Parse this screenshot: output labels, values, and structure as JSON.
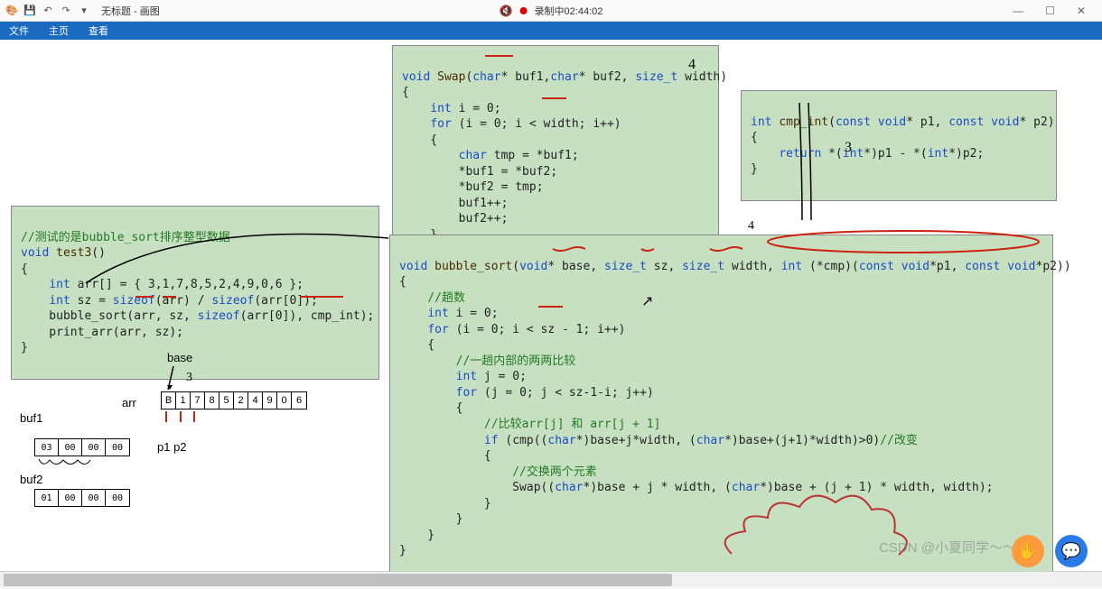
{
  "title_bar": {
    "app_title": "无标题 - 画图",
    "record_label": "录制中02:44:02"
  },
  "ribbon": {
    "file": "文件",
    "home": "主页",
    "view": "查看"
  },
  "panels": {
    "test": {
      "comment": "//测试的是bubble_sort排序整型数据",
      "l1": "void test3()",
      "l2": "{",
      "l3": "    int arr[] = { 3,1,7,8,5,2,4,9,0,6 };",
      "l4": "    int sz = sizeof(arr) / sizeof(arr[0]);",
      "l5": "    bubble_sort(arr, sz, sizeof(arr[0]), cmp_int);",
      "l6": "    print_arr(arr, sz);",
      "l7": "}"
    },
    "swap": {
      "l1": "void Swap(char* buf1,char* buf2, size_t width)",
      "l2": "{",
      "l3": "    int i = 0;",
      "l4": "    for (i = 0; i < width; i++)",
      "l5": "    {",
      "l6": "        char tmp = *buf1;",
      "l7": "        *buf1 = *buf2;",
      "l8": "        *buf2 = tmp;",
      "l9": "        buf1++;",
      "l10": "        buf2++;",
      "l11": "    }",
      "l12": "}"
    },
    "cmp": {
      "l1": "int cmp_int(const void* p1, const void* p2)",
      "l2": "{",
      "l3": "    return *(int*)p1 - *(int*)p2;",
      "l4": "}"
    },
    "bubble": {
      "l1": "void bubble_sort(void* base, size_t sz, size_t width, int (*cmp)(const void*p1, const void*p2))",
      "l2": "{",
      "l3": "    //趟数",
      "l4": "    int i = 0;",
      "l5": "    for (i = 0; i < sz - 1; i++)",
      "l6": "    {",
      "l7": "        //一趟内部的两两比较",
      "l8": "        int j = 0;",
      "l9": "        for (j = 0; j < sz-1-i; j++)",
      "l10": "        {",
      "l11": "            //比较arr[j] 和 arr[j + 1]",
      "l12": "            if (cmp((char*)base+j*width, (char*)base+(j+1)*width)>0)//改变",
      "l13": "            {",
      "l14": "                //交换两个元素",
      "l15": "                Swap((char*)base + j * width, (char*)base + (j + 1) * width, width);",
      "l16": "            }",
      "l17": "        }",
      "l18": "    }",
      "l19": "}"
    }
  },
  "labels": {
    "base": "base",
    "arr": "arr",
    "buf1": "buf1",
    "buf2": "buf2",
    "p1p2": "p1 p2"
  },
  "memory": {
    "arr_cells": [
      "B",
      "1",
      "7",
      "8",
      "5",
      "2",
      "4",
      "9",
      "0",
      "6"
    ],
    "buf1_cells": [
      "03",
      "00",
      "00",
      "00"
    ],
    "buf2_cells": [
      "01",
      "00",
      "00",
      "00"
    ]
  },
  "watermark": "CSDN @小夏同学～～～",
  "annotations": {
    "three": "3",
    "four": "4"
  }
}
